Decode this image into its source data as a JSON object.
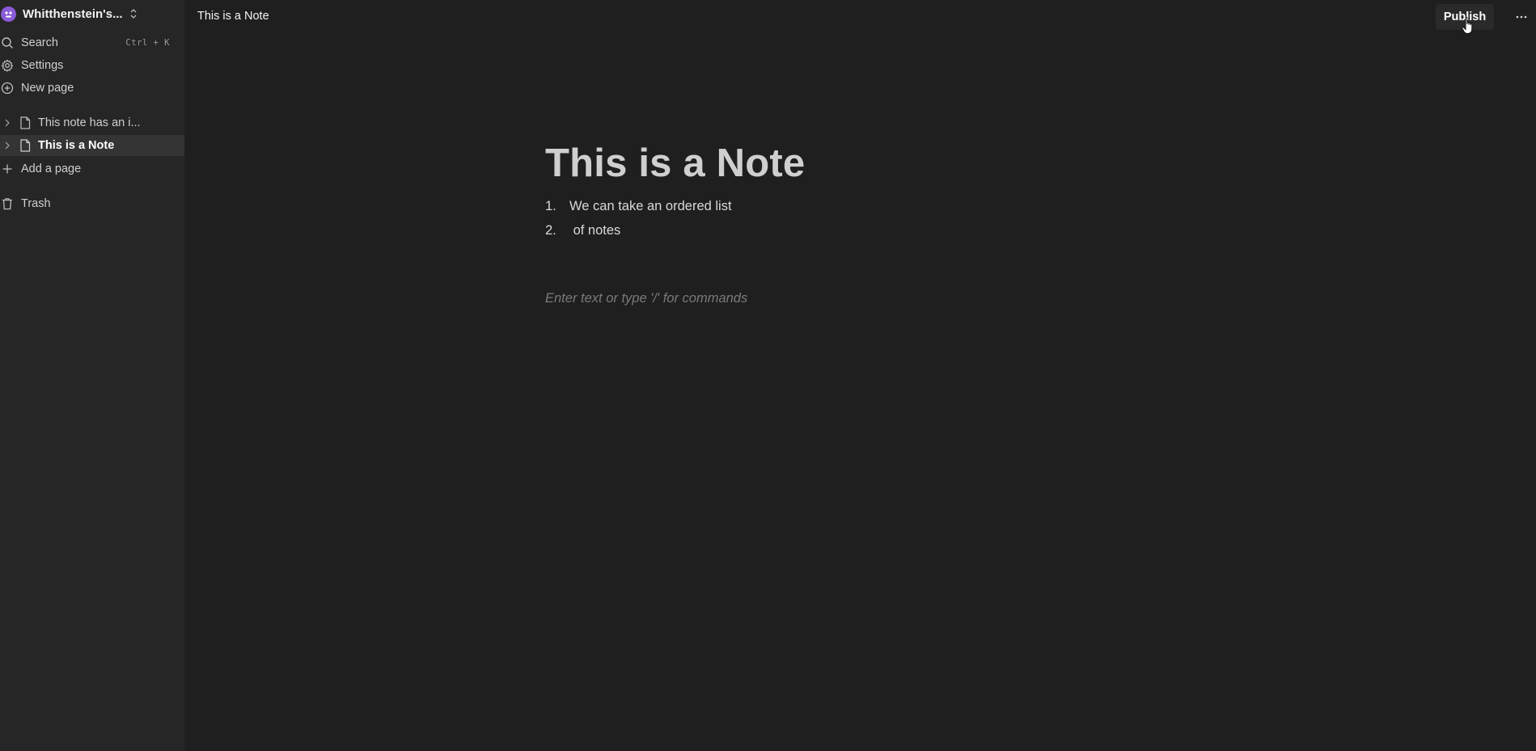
{
  "workspace": {
    "name": "Whitthenstein's..."
  },
  "nav": {
    "search_label": "Search",
    "search_shortcut": "Ctrl + K",
    "settings_label": "Settings",
    "new_page_label": "New page"
  },
  "pages": [
    {
      "label": "This note has an i...",
      "active": false
    },
    {
      "label": "This is a Note",
      "active": true
    }
  ],
  "add_page_label": "Add a page",
  "trash_label": "Trash",
  "header": {
    "doc_title": "This is a Note",
    "publish_label": "Publish",
    "more_label": "···"
  },
  "editor": {
    "title": "This is a Note",
    "list": [
      {
        "num": "1.",
        "text": "We can take an ordered list"
      },
      {
        "num": "2.",
        "text": " of notes"
      }
    ],
    "placeholder": "Enter text or type '/' for commands"
  },
  "colors": {
    "background": "#1f1f1f",
    "sidebar": "#262626",
    "active_item": "#343434",
    "avatar": "#8a5bd6"
  }
}
